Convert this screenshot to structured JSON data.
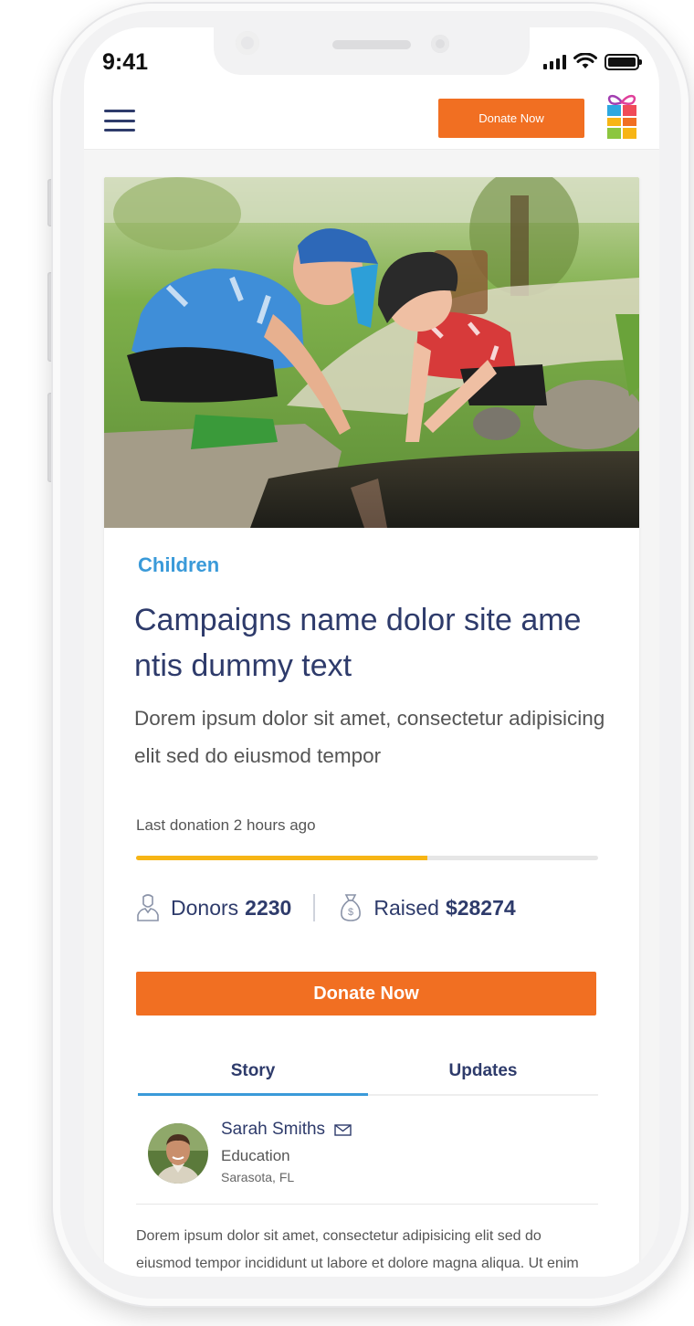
{
  "status_bar": {
    "time": "9:41"
  },
  "header": {
    "donate_label": "Donate Now"
  },
  "campaign": {
    "category": "Children",
    "title": "Campaigns name dolor site ame ntis dummy text",
    "subtitle": "Dorem ipsum dolor sit amet, consectetur adipisicing elit sed do eiusmod tempor",
    "last_donation": "Last donation 2 hours ago",
    "progress_fraction": 0.63,
    "donors_label": "Donors",
    "donors_count": "2230",
    "raised_label": "Raised",
    "raised_amount": "$28274",
    "cta_label": "Donate Now"
  },
  "tabs": [
    {
      "label": "Story",
      "active": true
    },
    {
      "label": "Updates",
      "active": false
    }
  ],
  "author": {
    "name": "Sarah Smiths",
    "role": "Education",
    "location": "Sarasota, FL"
  },
  "story_text": "Dorem ipsum dolor sit amet, consectetur adipisicing elit sed do eiusmod tempor incididunt ut labore et dolore  magna aliqua. Ut enim ad minim veniam, quis nostrud exercitation ullamco laboris",
  "colors": {
    "accent_orange": "#f16f22",
    "category_blue": "#3a9ad9",
    "navy": "#2e3b6b",
    "progress_yellow": "#f7b515"
  },
  "icons": [
    "hamburger-menu-icon",
    "gift-logo",
    "donor-person-icon",
    "money-bag-icon",
    "mail-icon",
    "signal-icon",
    "wifi-icon",
    "battery-icon"
  ]
}
